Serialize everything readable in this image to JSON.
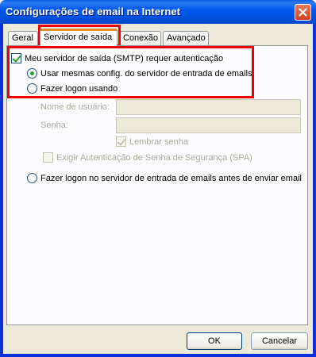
{
  "window": {
    "title": "Configurações de email na Internet"
  },
  "tabs": [
    {
      "label": "Geral"
    },
    {
      "label": "Servidor de saída"
    },
    {
      "label": "Conexão"
    },
    {
      "label": "Avançado"
    }
  ],
  "smtp": {
    "requires_auth_label": "Meu servidor de saída (SMTP) requer autenticação",
    "requires_auth_checked": true,
    "use_same_settings_label": "Usar mesmas config. do servidor de entrada de emails",
    "use_same_settings_selected": true,
    "log_on_using_label": "Fazer logon usando",
    "log_on_using_selected": false,
    "username_label": "Nome de usuário:",
    "username_value": "",
    "password_label": "Senha:",
    "password_value": "",
    "remember_password_label": "Lembrar senha",
    "remember_password_checked": true,
    "spa_label": "Exigir Autenticação de Senha de Segurança (SPA)",
    "spa_checked": false,
    "log_on_incoming_first_label": "Fazer logon no servidor de entrada de emails antes de enviar email",
    "log_on_incoming_first_selected": false
  },
  "buttons": {
    "ok": "OK",
    "cancel": "Cancelar"
  },
  "colors": {
    "highlight": "#ee0000",
    "titlebar": "#0058ee",
    "tab_accent": "#e68b2c"
  }
}
